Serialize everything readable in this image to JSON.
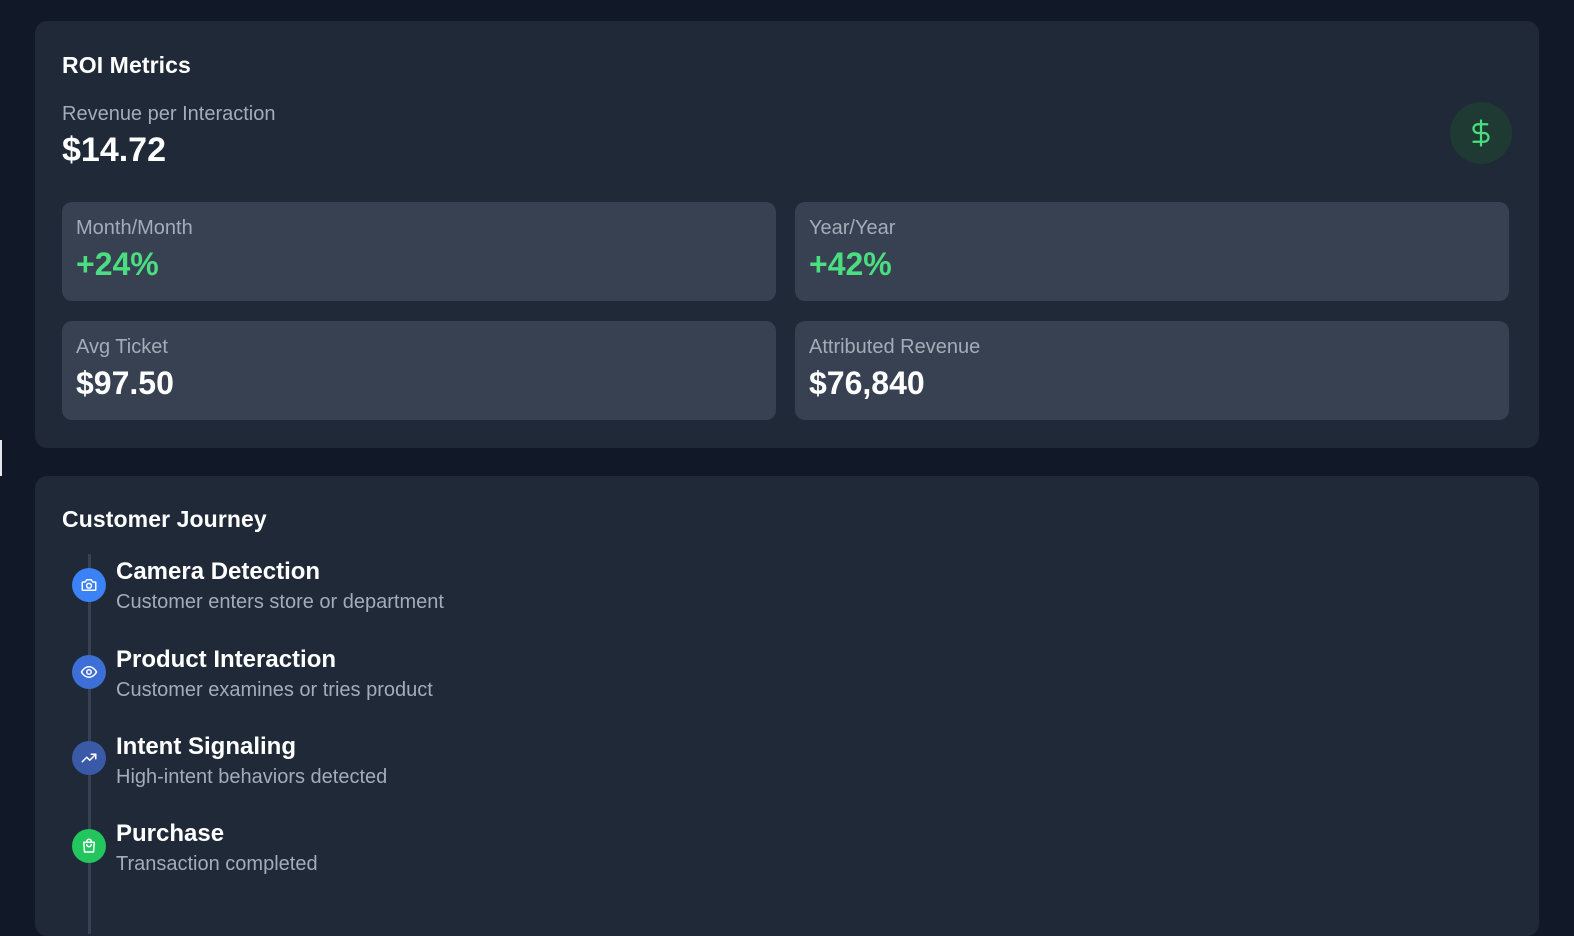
{
  "roi": {
    "title": "ROI Metrics",
    "revenue_per_interaction_label": "Revenue per Interaction",
    "revenue_per_interaction_value": "$14.72",
    "badge_icon": "dollar-icon",
    "stats": [
      {
        "label": "Month/Month",
        "value": "+24%",
        "color": "#4ade80"
      },
      {
        "label": "Year/Year",
        "value": "+42%",
        "color": "#4ade80"
      },
      {
        "label": "Avg Ticket",
        "value": "$97.50",
        "color": "#ffffff"
      },
      {
        "label": "Attributed Revenue",
        "value": "$76,840",
        "color": "#ffffff"
      }
    ]
  },
  "journey": {
    "title": "Customer Journey",
    "steps": [
      {
        "title": "Camera Detection",
        "description": "Customer enters store or department",
        "icon": "camera-icon",
        "color": "#3b82f6"
      },
      {
        "title": "Product Interaction",
        "description": "Customer examines or tries product",
        "icon": "eye-icon",
        "color": "#3d6fd6"
      },
      {
        "title": "Intent Signaling",
        "description": "High-intent behaviors detected",
        "icon": "trending-up-icon",
        "color": "#3a5aa8"
      },
      {
        "title": "Purchase",
        "description": "Transaction completed",
        "icon": "shopping-bag-icon",
        "color": "#22c55e"
      }
    ]
  }
}
